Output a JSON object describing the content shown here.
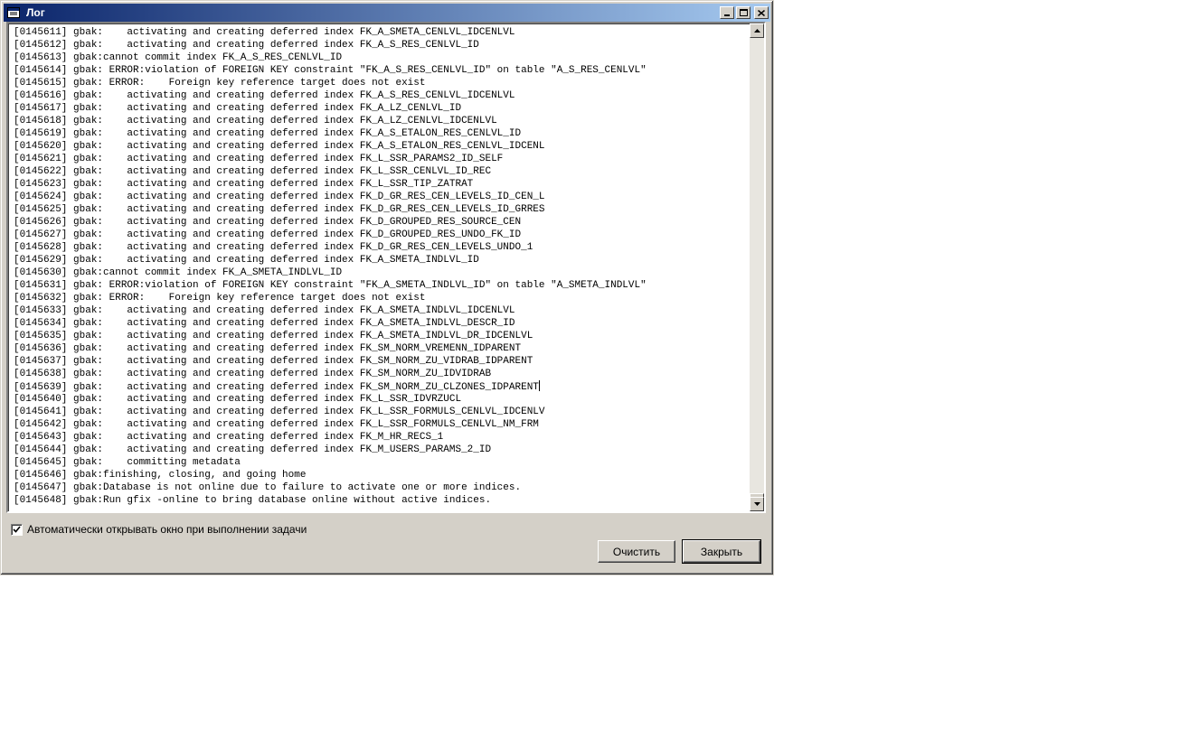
{
  "window": {
    "title": "Лог",
    "controls": {
      "minimize": "_",
      "maximize": "□",
      "close": "×"
    }
  },
  "log": {
    "lines": [
      "[0145611] gbak:    activating and creating deferred index FK_A_SMETA_CENLVL_IDCENLVL",
      "[0145612] gbak:    activating and creating deferred index FK_A_S_RES_CENLVL_ID",
      "[0145613] gbak:cannot commit index FK_A_S_RES_CENLVL_ID",
      "[0145614] gbak: ERROR:violation of FOREIGN KEY constraint \"FK_A_S_RES_CENLVL_ID\" on table \"A_S_RES_CENLVL\"",
      "[0145615] gbak: ERROR:    Foreign key reference target does not exist",
      "[0145616] gbak:    activating and creating deferred index FK_A_S_RES_CENLVL_IDCENLVL",
      "[0145617] gbak:    activating and creating deferred index FK_A_LZ_CENLVL_ID",
      "[0145618] gbak:    activating and creating deferred index FK_A_LZ_CENLVL_IDCENLVL",
      "[0145619] gbak:    activating and creating deferred index FK_A_S_ETALON_RES_CENLVL_ID",
      "[0145620] gbak:    activating and creating deferred index FK_A_S_ETALON_RES_CENLVL_IDCENL",
      "[0145621] gbak:    activating and creating deferred index FK_L_SSR_PARAMS2_ID_SELF",
      "[0145622] gbak:    activating and creating deferred index FK_L_SSR_CENLVL_ID_REC",
      "[0145623] gbak:    activating and creating deferred index FK_L_SSR_TIP_ZATRAT",
      "[0145624] gbak:    activating and creating deferred index FK_D_GR_RES_CEN_LEVELS_ID_CEN_L",
      "[0145625] gbak:    activating and creating deferred index FK_D_GR_RES_CEN_LEVELS_ID_GRRES",
      "[0145626] gbak:    activating and creating deferred index FK_D_GROUPED_RES_SOURCE_CEN",
      "[0145627] gbak:    activating and creating deferred index FK_D_GROUPED_RES_UNDO_FK_ID",
      "[0145628] gbak:    activating and creating deferred index FK_D_GR_RES_CEN_LEVELS_UNDO_1",
      "[0145629] gbak:    activating and creating deferred index FK_A_SMETA_INDLVL_ID",
      "[0145630] gbak:cannot commit index FK_A_SMETA_INDLVL_ID",
      "[0145631] gbak: ERROR:violation of FOREIGN KEY constraint \"FK_A_SMETA_INDLVL_ID\" on table \"A_SMETA_INDLVL\"",
      "[0145632] gbak: ERROR:    Foreign key reference target does not exist",
      "[0145633] gbak:    activating and creating deferred index FK_A_SMETA_INDLVL_IDCENLVL",
      "[0145634] gbak:    activating and creating deferred index FK_A_SMETA_INDLVL_DESCR_ID",
      "[0145635] gbak:    activating and creating deferred index FK_A_SMETA_INDLVL_DR_IDCENLVL",
      "[0145636] gbak:    activating and creating deferred index FK_SM_NORM_VREMENN_IDPARENT",
      "[0145637] gbak:    activating and creating deferred index FK_SM_NORM_ZU_VIDRAB_IDPARENT",
      "[0145638] gbak:    activating and creating deferred index FK_SM_NORM_ZU_IDVIDRAB",
      "[0145639] gbak:    activating and creating deferred index FK_SM_NORM_ZU_CLZONES_IDPARENT",
      "[0145640] gbak:    activating and creating deferred index FK_L_SSR_IDVRZUCL",
      "[0145641] gbak:    activating and creating deferred index FK_L_SSR_FORMULS_CENLVL_IDCENLV",
      "[0145642] gbak:    activating and creating deferred index FK_L_SSR_FORMULS_CENLVL_NM_FRM",
      "[0145643] gbak:    activating and creating deferred index FK_M_HR_RECS_1",
      "[0145644] gbak:    activating and creating deferred index FK_M_USERS_PARAMS_2_ID",
      "[0145645] gbak:    committing metadata",
      "[0145646] gbak:finishing, closing, and going home",
      "[0145647] gbak:Database is not online due to failure to activate one or more indices.",
      "[0145648] gbak:Run gfix -online to bring database online without active indices."
    ],
    "caret_line": 28
  },
  "options": {
    "auto_open_label": "Автоматически открывать окно при  выполнении задачи",
    "auto_open_checked": true
  },
  "buttons": {
    "clear_label": "Очистить",
    "close_label": "Закрыть"
  }
}
